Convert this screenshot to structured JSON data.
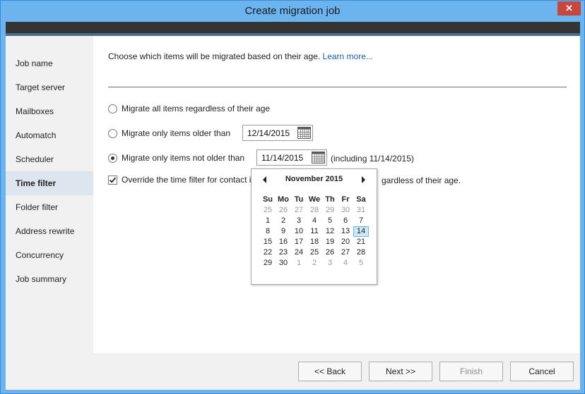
{
  "window": {
    "title": "Create migration job",
    "close_label": "✕"
  },
  "sidebar": {
    "items": [
      {
        "label": "Job name",
        "active": false
      },
      {
        "label": "Target server",
        "active": false
      },
      {
        "label": "Mailboxes",
        "active": false
      },
      {
        "label": "Automatch",
        "active": false
      },
      {
        "label": "Scheduler",
        "active": false
      },
      {
        "label": "Time filter",
        "active": true
      },
      {
        "label": "Folder filter",
        "active": false
      },
      {
        "label": "Address rewrite",
        "active": false
      },
      {
        "label": "Concurrency",
        "active": false
      },
      {
        "label": "Job summary",
        "active": false
      }
    ]
  },
  "main": {
    "intro_text": "Choose which items will be migrated based on their age.",
    "learn_more": "Learn more...",
    "options": {
      "all": {
        "label": "Migrate all items regardless of their age",
        "checked": false
      },
      "older": {
        "label": "Migrate only items older than",
        "checked": false,
        "date": "12/14/2015"
      },
      "not_older": {
        "label": "Migrate only items not older than",
        "checked": true,
        "date": "11/14/2015",
        "note": "(including 11/14/2015)"
      }
    },
    "override": {
      "label_start": "Override the time filter for contact i",
      "label_end": "gardless of their age.",
      "checked": true
    }
  },
  "calendar": {
    "month_label": "November 2015",
    "weekdays": [
      "Su",
      "Mo",
      "Tu",
      "We",
      "Th",
      "Fr",
      "Sa"
    ],
    "weeks": [
      [
        {
          "d": "25",
          "m": true
        },
        {
          "d": "26",
          "m": true
        },
        {
          "d": "27",
          "m": true
        },
        {
          "d": "28",
          "m": true
        },
        {
          "d": "29",
          "m": true
        },
        {
          "d": "30",
          "m": true
        },
        {
          "d": "31",
          "m": true
        }
      ],
      [
        {
          "d": "1"
        },
        {
          "d": "2"
        },
        {
          "d": "3"
        },
        {
          "d": "4"
        },
        {
          "d": "5"
        },
        {
          "d": "6"
        },
        {
          "d": "7"
        }
      ],
      [
        {
          "d": "8"
        },
        {
          "d": "9"
        },
        {
          "d": "10"
        },
        {
          "d": "11"
        },
        {
          "d": "12"
        },
        {
          "d": "13"
        },
        {
          "d": "14",
          "sel": true
        }
      ],
      [
        {
          "d": "15"
        },
        {
          "d": "16"
        },
        {
          "d": "17"
        },
        {
          "d": "18"
        },
        {
          "d": "19"
        },
        {
          "d": "20"
        },
        {
          "d": "21"
        }
      ],
      [
        {
          "d": "22"
        },
        {
          "d": "23"
        },
        {
          "d": "24"
        },
        {
          "d": "25"
        },
        {
          "d": "26"
        },
        {
          "d": "27"
        },
        {
          "d": "28"
        }
      ],
      [
        {
          "d": "29"
        },
        {
          "d": "30"
        },
        {
          "d": "1",
          "m": true
        },
        {
          "d": "2",
          "m": true
        },
        {
          "d": "3",
          "m": true
        },
        {
          "d": "4",
          "m": true
        },
        {
          "d": "5",
          "m": true
        }
      ]
    ]
  },
  "footer": {
    "back": "<< Back",
    "next": "Next >>",
    "finish": "Finish",
    "cancel": "Cancel"
  },
  "colors": {
    "titlebar": "#6cb4f0",
    "active_nav": "#dde5ef",
    "link": "#1c5fa6",
    "selected_day": "#cde8f7"
  }
}
